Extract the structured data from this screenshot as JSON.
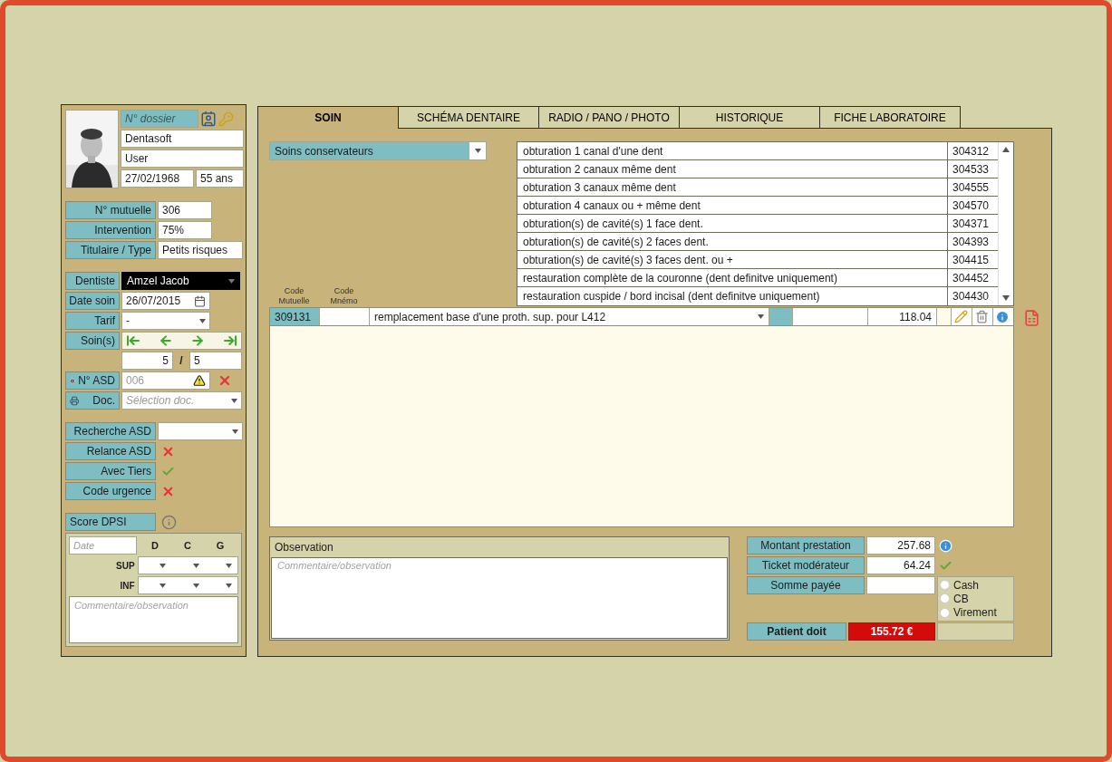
{
  "patient": {
    "dossier_placeholder": "N° dossier",
    "last_name": "Dentasoft",
    "first_name": "User",
    "birth_date": "27/02/1968",
    "age": "55 ans"
  },
  "insurance": [
    {
      "label": "N° mutuelle",
      "value": "306"
    },
    {
      "label": "Intervention",
      "value": "75%"
    },
    {
      "label": "Titulaire / Type",
      "value": "Petits risques"
    }
  ],
  "care": {
    "dentist_label": "Dentiste",
    "dentist": "Amzel Jacob",
    "date_label": "Date soin",
    "date": "26/07/2015",
    "tarif_label": "Tarif",
    "tarif": "-",
    "soins_label": "Soin(s)",
    "current": "5",
    "separator": "/",
    "total": "5",
    "asd_label": "N° ASD",
    "asd": "006",
    "doc_label": "Doc.",
    "doc_placeholder": "Sélection doc."
  },
  "asd_search": {
    "label": "Recherche ASD"
  },
  "flags": [
    {
      "label": "Relance ASD",
      "on": false
    },
    {
      "label": "Avec Tiers",
      "on": true
    },
    {
      "label": "Code urgence",
      "on": false
    }
  ],
  "dpsi": {
    "label": "Score DPSI",
    "date_placeholder": "Date",
    "columns": [
      "D",
      "C",
      "G"
    ],
    "rows": [
      "SUP",
      "INF"
    ],
    "comment_placeholder": "Commentaire/observation"
  },
  "tabs": [
    {
      "label": "SOIN",
      "selected": true
    },
    {
      "label": "SCHÉMA DENTAIRE",
      "selected": false
    },
    {
      "label": "RADIO / PANO / PHOTO",
      "selected": false
    },
    {
      "label": "HISTORIQUE",
      "selected": false
    },
    {
      "label": "FICHE LABORATOIRE",
      "selected": false
    }
  ],
  "category": "Soins conservateurs",
  "treatments": [
    {
      "name": "obturation 1 canal d'une dent",
      "code": "304312"
    },
    {
      "name": "obturation 2 canaux même dent",
      "code": "304533"
    },
    {
      "name": "obturation 3 canaux même dent",
      "code": "304555"
    },
    {
      "name": "obturation 4 canaux  ou + même dent",
      "code": "304570"
    },
    {
      "name": "obturation(s) de cavité(s) 1 face dent.",
      "code": "304371"
    },
    {
      "name": "obturation(s) de cavité(s) 2 faces dent.",
      "code": "304393"
    },
    {
      "name": "obturation(s) de cavité(s) 3 faces dent. ou +",
      "code": "304415"
    },
    {
      "name": "restauration complète de la couronne (dent definitve uniquement)",
      "code": "304452"
    },
    {
      "name": "restauration cuspide / bord incisal (dent definitve uniquement)",
      "code": "304430"
    }
  ],
  "line_headers": [
    "Code Mutuelle",
    "Code Mnémo"
  ],
  "line": {
    "code": "309131",
    "description": "remplacement base d'une proth. sup. pour L412",
    "amount": "118.04"
  },
  "observation": {
    "title": "Observation",
    "placeholder": "Commentaire/observation"
  },
  "totals": [
    {
      "label": "Montant prestation",
      "value": "257.68",
      "kind": "info"
    },
    {
      "label": "Ticket modérateur",
      "value": "64.24",
      "kind": "check"
    },
    {
      "label": "Somme payée",
      "kind": "plain"
    }
  ],
  "payment_methods": [
    {
      "label": "Cash",
      "selected": false
    },
    {
      "label": "CB",
      "selected": false
    },
    {
      "label": "Virement",
      "selected": false
    }
  ],
  "due": {
    "label": "Patient doit",
    "value": "155.72 €"
  }
}
